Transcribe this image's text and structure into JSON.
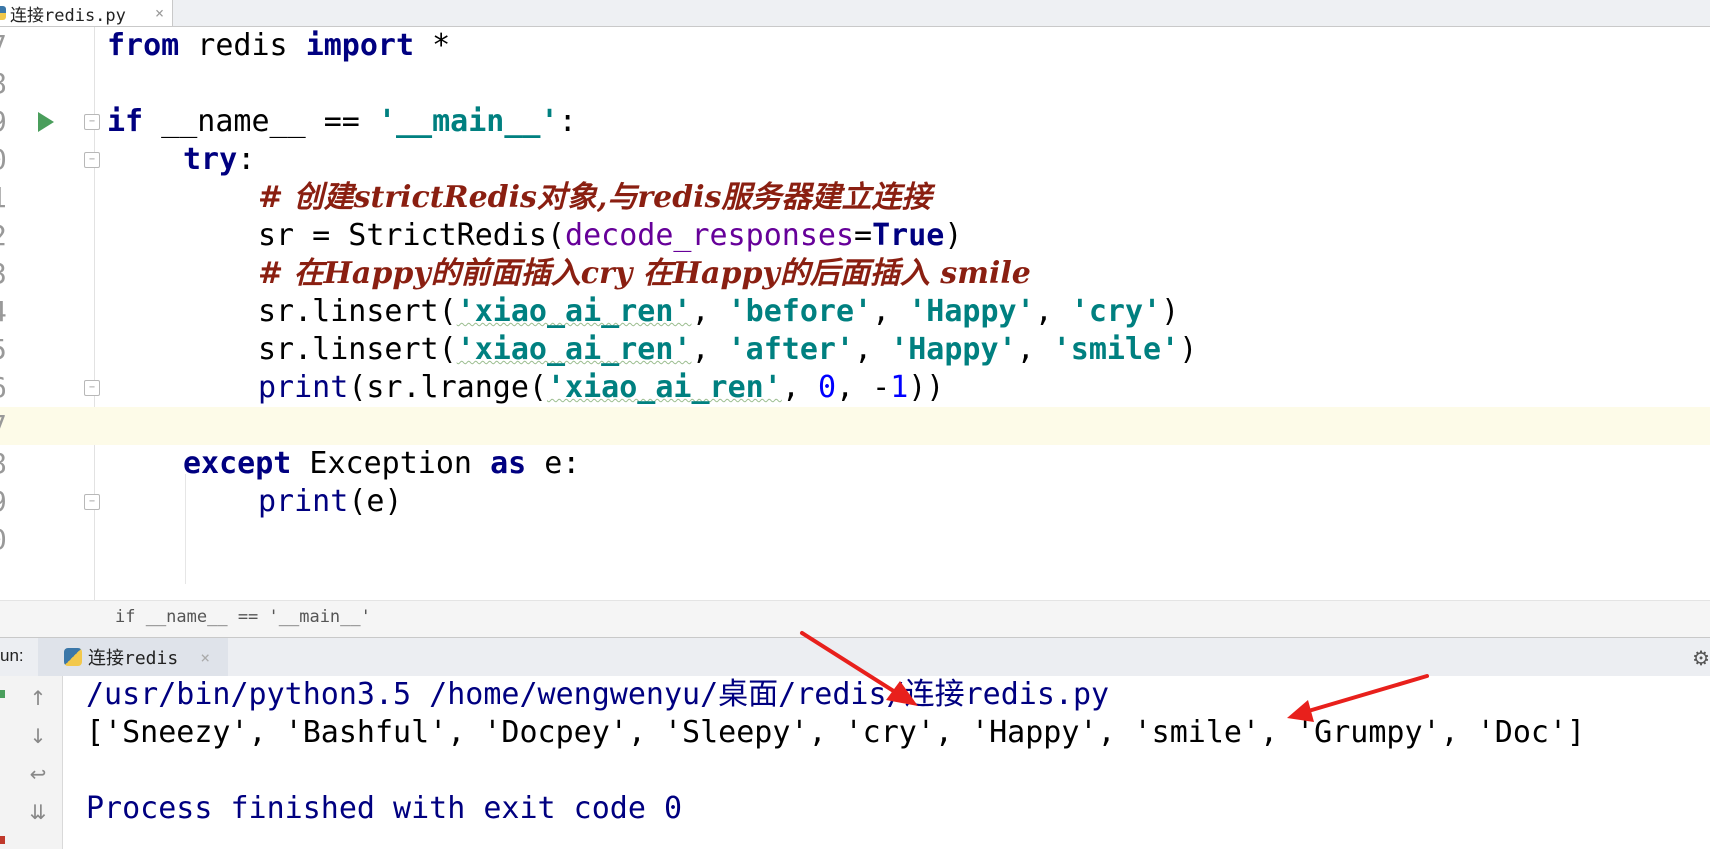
{
  "editor_tab": {
    "filename": "连接redis.py",
    "close": "×"
  },
  "code_lines": [
    {
      "num": "7"
    },
    {
      "num": "8"
    },
    {
      "num": "9"
    },
    {
      "num": "0"
    },
    {
      "num": "1"
    },
    {
      "num": "2"
    },
    {
      "num": "3"
    },
    {
      "num": "4"
    },
    {
      "num": "5"
    },
    {
      "num": "6"
    },
    {
      "num": "7"
    },
    {
      "num": "8"
    },
    {
      "num": "9"
    },
    {
      "num": "0"
    }
  ],
  "code": {
    "l7_from": "from",
    "l7_mod": " redis ",
    "l7_import": "import",
    "l7_star": " *",
    "l9_if": "if",
    "l9_name": " __name__ == ",
    "l9_str": "'__main__'",
    "l9_colon": ":",
    "l10_try": "try",
    "l10_colon": ":",
    "l11_comment": "# 创建strictRedis对象,与redis服务器建立连接",
    "l12_a": "sr = StrictRedis(",
    "l12_param": "decode_responses",
    "l12_eq": "=",
    "l12_true": "True",
    "l12_close": ")",
    "l13_comment": "# 在Happy的前面插入cry 在Happy的后面插入 smile",
    "l14_a": "sr.linsert(",
    "l14_s1": "'xiao_ai_ren'",
    "l14_c1": ", ",
    "l14_s2": "'before'",
    "l14_c2": ", ",
    "l14_s3": "'Happy'",
    "l14_c3": ", ",
    "l14_s4": "'cry'",
    "l14_close": ")",
    "l15_a": "sr.linsert(",
    "l15_s1": "'xiao_ai_ren'",
    "l15_c1": ", ",
    "l15_s2": "'after'",
    "l15_c2": ", ",
    "l15_s3": "'Happy'",
    "l15_c3": ", ",
    "l15_s4": "'smile'",
    "l15_close": ")",
    "l16_print": "print",
    "l16_a": "(sr.lrange(",
    "l16_s1": "'xiao_ai_ren'",
    "l16_c1": ", ",
    "l16_n0": "0",
    "l16_c2": ", -",
    "l16_n1": "1",
    "l16_close": "))",
    "l18_except": "except",
    "l18_exc": " Exception ",
    "l18_as": "as",
    "l18_e": " e:",
    "l19_print": "print",
    "l19_rest": "(e)"
  },
  "breadcrumb": "if __name__ == '__main__'",
  "run_panel": {
    "label": "un:",
    "tab_name": "连接redis",
    "close": "×",
    "settings_icon": "gear-icon"
  },
  "console": {
    "path_line": "/usr/bin/python3.5 /home/wengwenyu/桌面/redis/连接redis.py",
    "result_line": "['Sneezy', 'Bashful', 'Docpey', 'Sleepy', 'cry', 'Happy', 'smile', 'Grumpy', 'Doc']",
    "process_line": "Process finished with exit code 0"
  },
  "colors": {
    "keyword": "#000080",
    "string": "#008080",
    "comment": "#8a1f11",
    "annotation_arrow": "#e8201c",
    "current_line": "#fdfbe8"
  }
}
